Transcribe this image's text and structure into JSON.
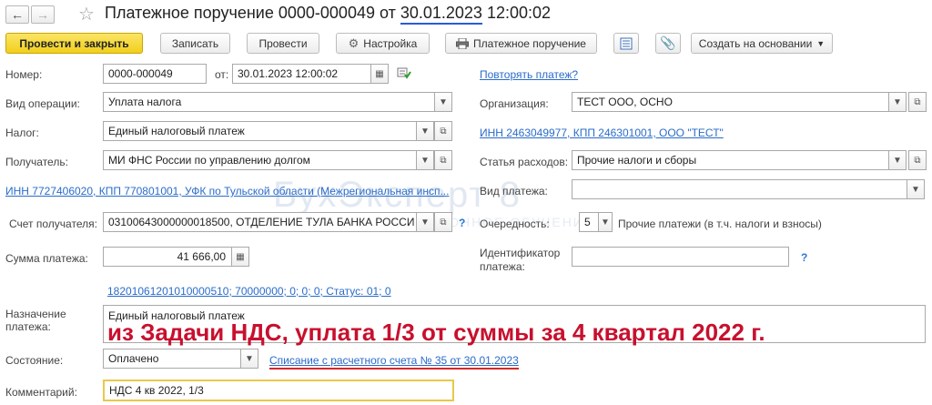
{
  "header": {
    "title_prefix": "Платежное поручение 0000-000049 от ",
    "title_date": "30.01.2023",
    "title_time": " 12:00:02"
  },
  "toolbar": {
    "post_close": "Провести и закрыть",
    "save": "Записать",
    "post": "Провести",
    "settings": "Настройка",
    "print_order": "Платежное поручение",
    "create_based": "Создать на основании"
  },
  "form": {
    "number_label": "Номер:",
    "number": "0000-000049",
    "from_label": "от:",
    "datetime": "30.01.2023 12:00:02",
    "repeat_link": "Повторять платеж?",
    "op_type_label": "Вид операции:",
    "op_type": "Уплата налога",
    "org_label": "Организация:",
    "org": "ТЕСТ ООО, ОСНО",
    "tax_label": "Налог:",
    "tax": "Единый налоговый платеж",
    "org_inn_link": "ИНН 2463049977, КПП 246301001, ООО \"ТЕСТ\"",
    "recipient_label": "Получатель:",
    "recipient": "МИ ФНС России по управлению долгом",
    "expense_label": "Статья расходов:",
    "expense": "Прочие налоги и сборы",
    "recipient_inn_link": "ИНН 7727406020, КПП 770801001, УФК по Тульской области (Межрегиональная инсп...",
    "payment_kind_label": "Вид платежа:",
    "payment_kind": "",
    "account_label": "Счет получателя:",
    "account": "03100643000000018500, ОТДЕЛЕНИЕ ТУЛА БАНКА РОССИ",
    "priority_label": "Очередность:",
    "priority": "5",
    "priority_desc": "Прочие платежи (в т.ч. налоги и взносы)",
    "amount_label": "Сумма платежа:",
    "amount": "41 666,00",
    "identifier_label_1": "Идентификатор",
    "identifier_label_2": "платежа:",
    "identifier": "",
    "kbk_link": "18201061201010000510; 70000000; 0; 0; 0; Статус: 01; 0",
    "purpose_label_1": "Назначение",
    "purpose_label_2": "платежа:",
    "purpose": "Единый налоговый платеж",
    "state_label": "Состояние:",
    "state": "Оплачено",
    "writeoff_link": "Списание с расчетного счета № 35 от 30.01.2023",
    "comment_label": "Комментарий:",
    "comment": "НДС 4 кв 2022, 1/3",
    "help_mark": "?"
  },
  "overlay": {
    "annotation": "из Задачи НДС, уплата 1/3 от суммы за 4 квартал 2022 г.",
    "watermark": "БухЭксперт 8",
    "watermark_sub": "ДИСТАНЦИОННОЕ ОБУЧЕНИЕ"
  },
  "colors": {
    "primary_button": "#f1cf1d",
    "link": "#2a6cc9",
    "annotation": "#c8102e",
    "active_field_border": "#e8c84a",
    "date_underline": "#2a5bd7",
    "link_underline": "#d42a2a"
  }
}
